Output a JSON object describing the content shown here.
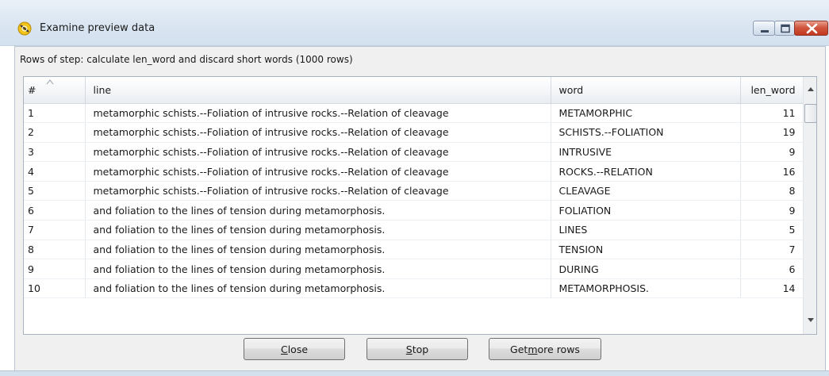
{
  "window": {
    "title": "Examine preview data",
    "controls": [
      "minimize-icon",
      "maximize-icon",
      "close-icon"
    ],
    "accent_color": "#c2391f"
  },
  "caption": "Rows of step: calculate len_word and discard short words (1000 rows)",
  "table": {
    "columns": [
      "#",
      "line",
      "word",
      "len_word"
    ],
    "rows": [
      [
        "1",
        "metamorphic schists.--Foliation of intrusive rocks.--Relation of cleavage",
        "METAMORPHIC",
        "11"
      ],
      [
        "2",
        "metamorphic schists.--Foliation of intrusive rocks.--Relation of cleavage",
        "SCHISTS.--FOLIATION",
        "19"
      ],
      [
        "3",
        "metamorphic schists.--Foliation of intrusive rocks.--Relation of cleavage",
        "INTRUSIVE",
        "9"
      ],
      [
        "4",
        "metamorphic schists.--Foliation of intrusive rocks.--Relation of cleavage",
        "ROCKS.--RELATION",
        "16"
      ],
      [
        "5",
        "metamorphic schists.--Foliation of intrusive rocks.--Relation of cleavage",
        "CLEAVAGE",
        "8"
      ],
      [
        "6",
        "and foliation to the lines of tension during metamorphosis.",
        "FOLIATION",
        "9"
      ],
      [
        "7",
        "and foliation to the lines of tension during metamorphosis.",
        "LINES",
        "5"
      ],
      [
        "8",
        "and foliation to the lines of tension during metamorphosis.",
        "TENSION",
        "7"
      ],
      [
        "9",
        "and foliation to the lines of tension during metamorphosis.",
        "DURING",
        "6"
      ],
      [
        "10",
        "and foliation to the lines of tension during metamorphosis.",
        "METAMORPHOSIS.",
        "14"
      ]
    ]
  },
  "buttons": {
    "close_pre": "",
    "close_mnemonic": "C",
    "close_post": "lose",
    "stop_pre": "",
    "stop_mnemonic": "S",
    "stop_post": "top",
    "more_pre": "Get ",
    "more_mnemonic": "m",
    "more_post": "ore rows"
  }
}
